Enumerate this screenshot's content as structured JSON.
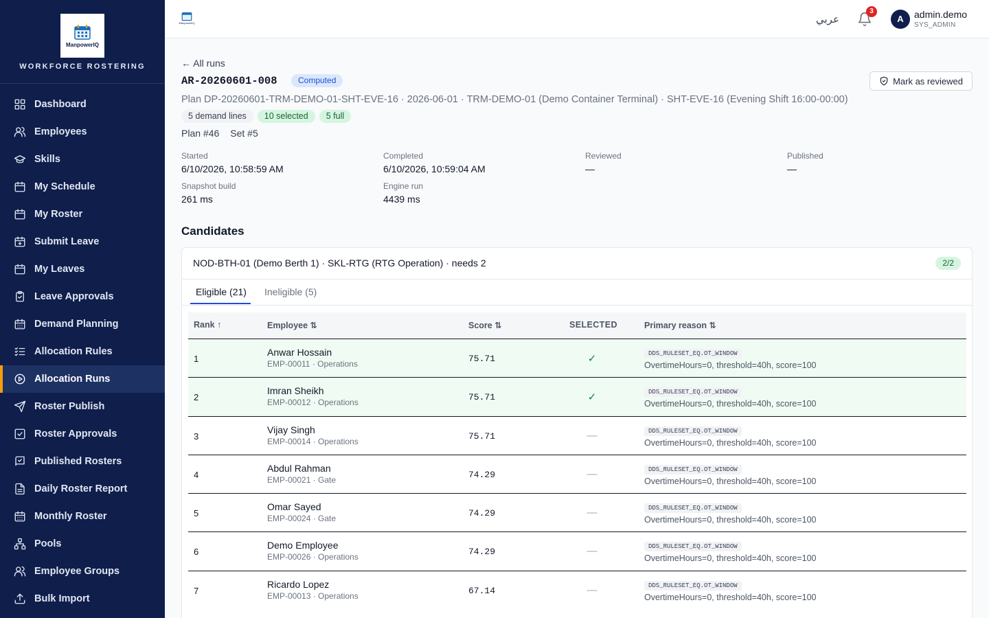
{
  "sidebar": {
    "logo_text": "ManpowerIQ",
    "brand_title": "WORKFORCE ROSTERING",
    "items": [
      {
        "label": "Dashboard",
        "icon": "grid-icon"
      },
      {
        "label": "Employees",
        "icon": "users-icon"
      },
      {
        "label": "Skills",
        "icon": "graduation-cap-icon"
      },
      {
        "label": "My Schedule",
        "icon": "calendar-icon"
      },
      {
        "label": "My Roster",
        "icon": "calendar-icon"
      },
      {
        "label": "Submit Leave",
        "icon": "calendar-plus-icon"
      },
      {
        "label": "My Leaves",
        "icon": "calendar-icon"
      },
      {
        "label": "Leave Approvals",
        "icon": "clipboard-check-icon"
      },
      {
        "label": "Demand Planning",
        "icon": "calendar-grid-icon"
      },
      {
        "label": "Allocation Rules",
        "icon": "list-checks-icon"
      },
      {
        "label": "Allocation Runs",
        "icon": "play-circle-icon",
        "active": true
      },
      {
        "label": "Roster Publish",
        "icon": "send-icon"
      },
      {
        "label": "Roster Approvals",
        "icon": "check-square-icon"
      },
      {
        "label": "Published Rosters",
        "icon": "book-check-icon"
      },
      {
        "label": "Daily Roster Report",
        "icon": "file-text-icon"
      },
      {
        "label": "Monthly Roster",
        "icon": "calendar-grid-icon"
      },
      {
        "label": "Pools",
        "icon": "network-icon"
      },
      {
        "label": "Employee Groups",
        "icon": "users-icon"
      },
      {
        "label": "Bulk Import",
        "icon": "upload-icon"
      }
    ]
  },
  "topbar": {
    "logo_text": "ManpowerIQ",
    "language": "عربي",
    "notification_count": "3",
    "avatar_initial": "A",
    "username": "admin.demo",
    "role": "SYS_ADMIN"
  },
  "run": {
    "back_link": "← All runs",
    "id": "AR-20260601-008",
    "status": "Computed",
    "review_button": "Mark as reviewed",
    "plan_line": "Plan DP-20260601-TRM-DEMO-01-SHT-EVE-16 · 2026-06-01 · TRM-DEMO-01 (Demo Container Terminal) · SHT-EVE-16 (Evening Shift 16:00-00:00)",
    "chips": {
      "demand_lines": "5 demand lines",
      "selected": "10 selected",
      "full": "5 full"
    },
    "plan_no": "Plan #46",
    "set_no": "Set #5",
    "meta": {
      "started_label": "Started",
      "started": "6/10/2026, 10:58:59 AM",
      "completed_label": "Completed",
      "completed": "6/10/2026, 10:59:04 AM",
      "reviewed_label": "Reviewed",
      "reviewed": "—",
      "published_label": "Published",
      "published": "—",
      "snapshot_label": "Snapshot build",
      "snapshot": "261 ms",
      "engine_label": "Engine run",
      "engine": "4439 ms"
    }
  },
  "candidates": {
    "title": "Candidates",
    "group_title": "NOD-BTH-01 (Demo Berth 1) · SKL-RTG (RTG Operation) · needs 2",
    "group_count": "2/2",
    "tab_eligible": "Eligible (21)",
    "tab_ineligible": "Ineligible (5)",
    "columns": {
      "rank": "Rank ↑",
      "employee": "Employee ⇅",
      "score": "Score ⇅",
      "selected": "SELECTED",
      "reason": "Primary reason ⇅"
    },
    "rows": [
      {
        "rank": "1",
        "name": "Anwar Hossain",
        "sub": "EMP-00011 · Operations",
        "score": "75.71",
        "selected": "✓",
        "is_selected": true,
        "code": "DDS_RULESET_EQ.OT_WINDOW",
        "detail": "OvertimeHours=0, threshold=40h, score=100"
      },
      {
        "rank": "2",
        "name": "Imran Sheikh",
        "sub": "EMP-00012 · Operations",
        "score": "75.71",
        "selected": "✓",
        "is_selected": true,
        "code": "DDS_RULESET_EQ.OT_WINDOW",
        "detail": "OvertimeHours=0, threshold=40h, score=100"
      },
      {
        "rank": "3",
        "name": "Vijay Singh",
        "sub": "EMP-00014 · Operations",
        "score": "75.71",
        "selected": "—",
        "is_selected": false,
        "code": "DDS_RULESET_EQ.OT_WINDOW",
        "detail": "OvertimeHours=0, threshold=40h, score=100"
      },
      {
        "rank": "4",
        "name": "Abdul Rahman",
        "sub": "EMP-00021 · Gate",
        "score": "74.29",
        "selected": "—",
        "is_selected": false,
        "code": "DDS_RULESET_EQ.OT_WINDOW",
        "detail": "OvertimeHours=0, threshold=40h, score=100"
      },
      {
        "rank": "5",
        "name": "Omar Sayed",
        "sub": "EMP-00024 · Gate",
        "score": "74.29",
        "selected": "—",
        "is_selected": false,
        "code": "DDS_RULESET_EQ.OT_WINDOW",
        "detail": "OvertimeHours=0, threshold=40h, score=100"
      },
      {
        "rank": "6",
        "name": "Demo Employee",
        "sub": "EMP-00026 · Operations",
        "score": "74.29",
        "selected": "—",
        "is_selected": false,
        "code": "DDS_RULESET_EQ.OT_WINDOW",
        "detail": "OvertimeHours=0, threshold=40h, score=100"
      },
      {
        "rank": "7",
        "name": "Ricardo Lopez",
        "sub": "EMP-00013 · Operations",
        "score": "67.14",
        "selected": "—",
        "is_selected": false,
        "code": "DDS_RULESET_EQ.OT_WINDOW",
        "detail": "OvertimeHours=0, threshold=40h, score=100"
      }
    ]
  }
}
